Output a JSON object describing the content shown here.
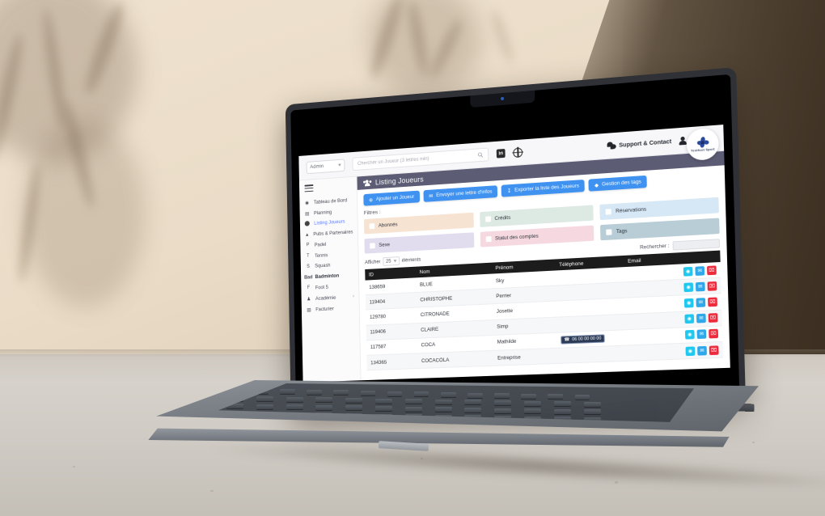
{
  "app": {
    "topbar": {
      "role_select": "Admin",
      "search_placeholder": "Chercher un Joueur (3 lettres min)",
      "search_icon": "search-icon",
      "linkedin_label": "in",
      "globe_icon": "globe-icon",
      "support_label": "Support & Contact",
      "account_icon": "user-icon",
      "brand_name": "Testfoot Sport"
    },
    "sidebar": {
      "menu_icon": "hamburger-menu-icon",
      "items": [
        {
          "label": "Tableau de Bord",
          "icon": "dashboard-icon",
          "active": false,
          "heading": false,
          "chevron": false
        },
        {
          "label": "Planning",
          "icon": "calendar-icon",
          "active": false,
          "heading": false,
          "chevron": false
        },
        {
          "label": "Listing Joueurs",
          "icon": "users-icon",
          "active": true,
          "heading": false,
          "chevron": false
        },
        {
          "label": "Pubs & Partenaires",
          "icon": "thumbs-up-icon",
          "active": false,
          "heading": false,
          "chevron": false
        },
        {
          "label": "Padel",
          "icon": "P",
          "active": false,
          "heading": false,
          "chevron": false
        },
        {
          "label": "Tennis",
          "icon": "T",
          "active": false,
          "heading": false,
          "chevron": false
        },
        {
          "label": "Squash",
          "icon": "S",
          "active": false,
          "heading": false,
          "chevron": false
        },
        {
          "label": "Bad Badminton",
          "icon": "Bad",
          "active": false,
          "heading": true,
          "chevron": false
        },
        {
          "label": "Foot 5",
          "icon": "F",
          "active": false,
          "heading": false,
          "chevron": false
        },
        {
          "label": "Académie",
          "icon": "trophy-icon",
          "active": false,
          "heading": false,
          "chevron": true
        },
        {
          "label": "Facturier",
          "icon": "invoice-icon",
          "active": false,
          "heading": false,
          "chevron": false
        }
      ]
    },
    "panel": {
      "title": "Listing Joueurs",
      "title_icon": "users-icon",
      "buttons": [
        {
          "label": "Ajouter un Joueur",
          "icon": "plus-circle-icon"
        },
        {
          "label": "Envoyer une lettre d'infos",
          "icon": "envelope-icon"
        },
        {
          "label": "Exporter la liste des Joueurs",
          "icon": "download-icon"
        },
        {
          "label": "Gestion des tags",
          "icon": "tag-icon"
        }
      ],
      "filters_label": "Filtres :",
      "filters": [
        {
          "label": "Abonnés",
          "color": "#f7e3d2"
        },
        {
          "label": "Crédits",
          "color": "#dde9e3"
        },
        {
          "label": "Réservations",
          "color": "#d6e8f6"
        },
        {
          "label": "Sexe",
          "color": "#e2ddee"
        },
        {
          "label": "Statut des comptes",
          "color": "#f6d9e0"
        },
        {
          "label": "Tags",
          "color": "#b8cdd6"
        }
      ],
      "table_tools": {
        "show_prefix": "Afficher",
        "page_size": "25",
        "show_suffix": "éléments",
        "search_label": "Rechercher :",
        "search_value": ""
      },
      "table": {
        "columns": [
          "ID",
          "Nom",
          "Prénom",
          "Téléphone",
          "Email"
        ],
        "rows": [
          {
            "id": "138659",
            "nom": "BLUE",
            "prenom": "Sky",
            "telephone": "",
            "email": ""
          },
          {
            "id": "119404",
            "nom": "CHRISTOPHE",
            "prenom": "Perrier",
            "telephone": "",
            "email": ""
          },
          {
            "id": "129780",
            "nom": "CITRONADE",
            "prenom": "Josette",
            "telephone": "",
            "email": ""
          },
          {
            "id": "119406",
            "nom": "CLAIRE",
            "prenom": "Simp",
            "telephone": "",
            "email": ""
          },
          {
            "id": "117587",
            "nom": "COCA",
            "prenom": "Mathilde",
            "telephone": "06 00 00 00 00",
            "email": ""
          },
          {
            "id": "134365",
            "nom": "COCACOLA",
            "prenom": "Entreprise",
            "telephone": "",
            "email": ""
          }
        ],
        "row_actions": [
          {
            "name": "view-row-button",
            "icon": "eye-icon",
            "glyph": "◉",
            "kind": "view"
          },
          {
            "name": "email-row-button",
            "icon": "envelope-icon",
            "glyph": "✉",
            "kind": "mail"
          },
          {
            "name": "delete-row-button",
            "icon": "trash-icon",
            "glyph": "Ὕ1",
            "kind": "del"
          }
        ]
      }
    }
  },
  "colors": {
    "accent_blue": "#3f92f0",
    "panel_header": "#5c5c74",
    "active_nav": "#5b7cfa",
    "table_header": "#1c1c1c",
    "action_view": "#1ec8ef",
    "action_mail": "#2fa8ea",
    "action_delete": "#ee2b3d"
  }
}
